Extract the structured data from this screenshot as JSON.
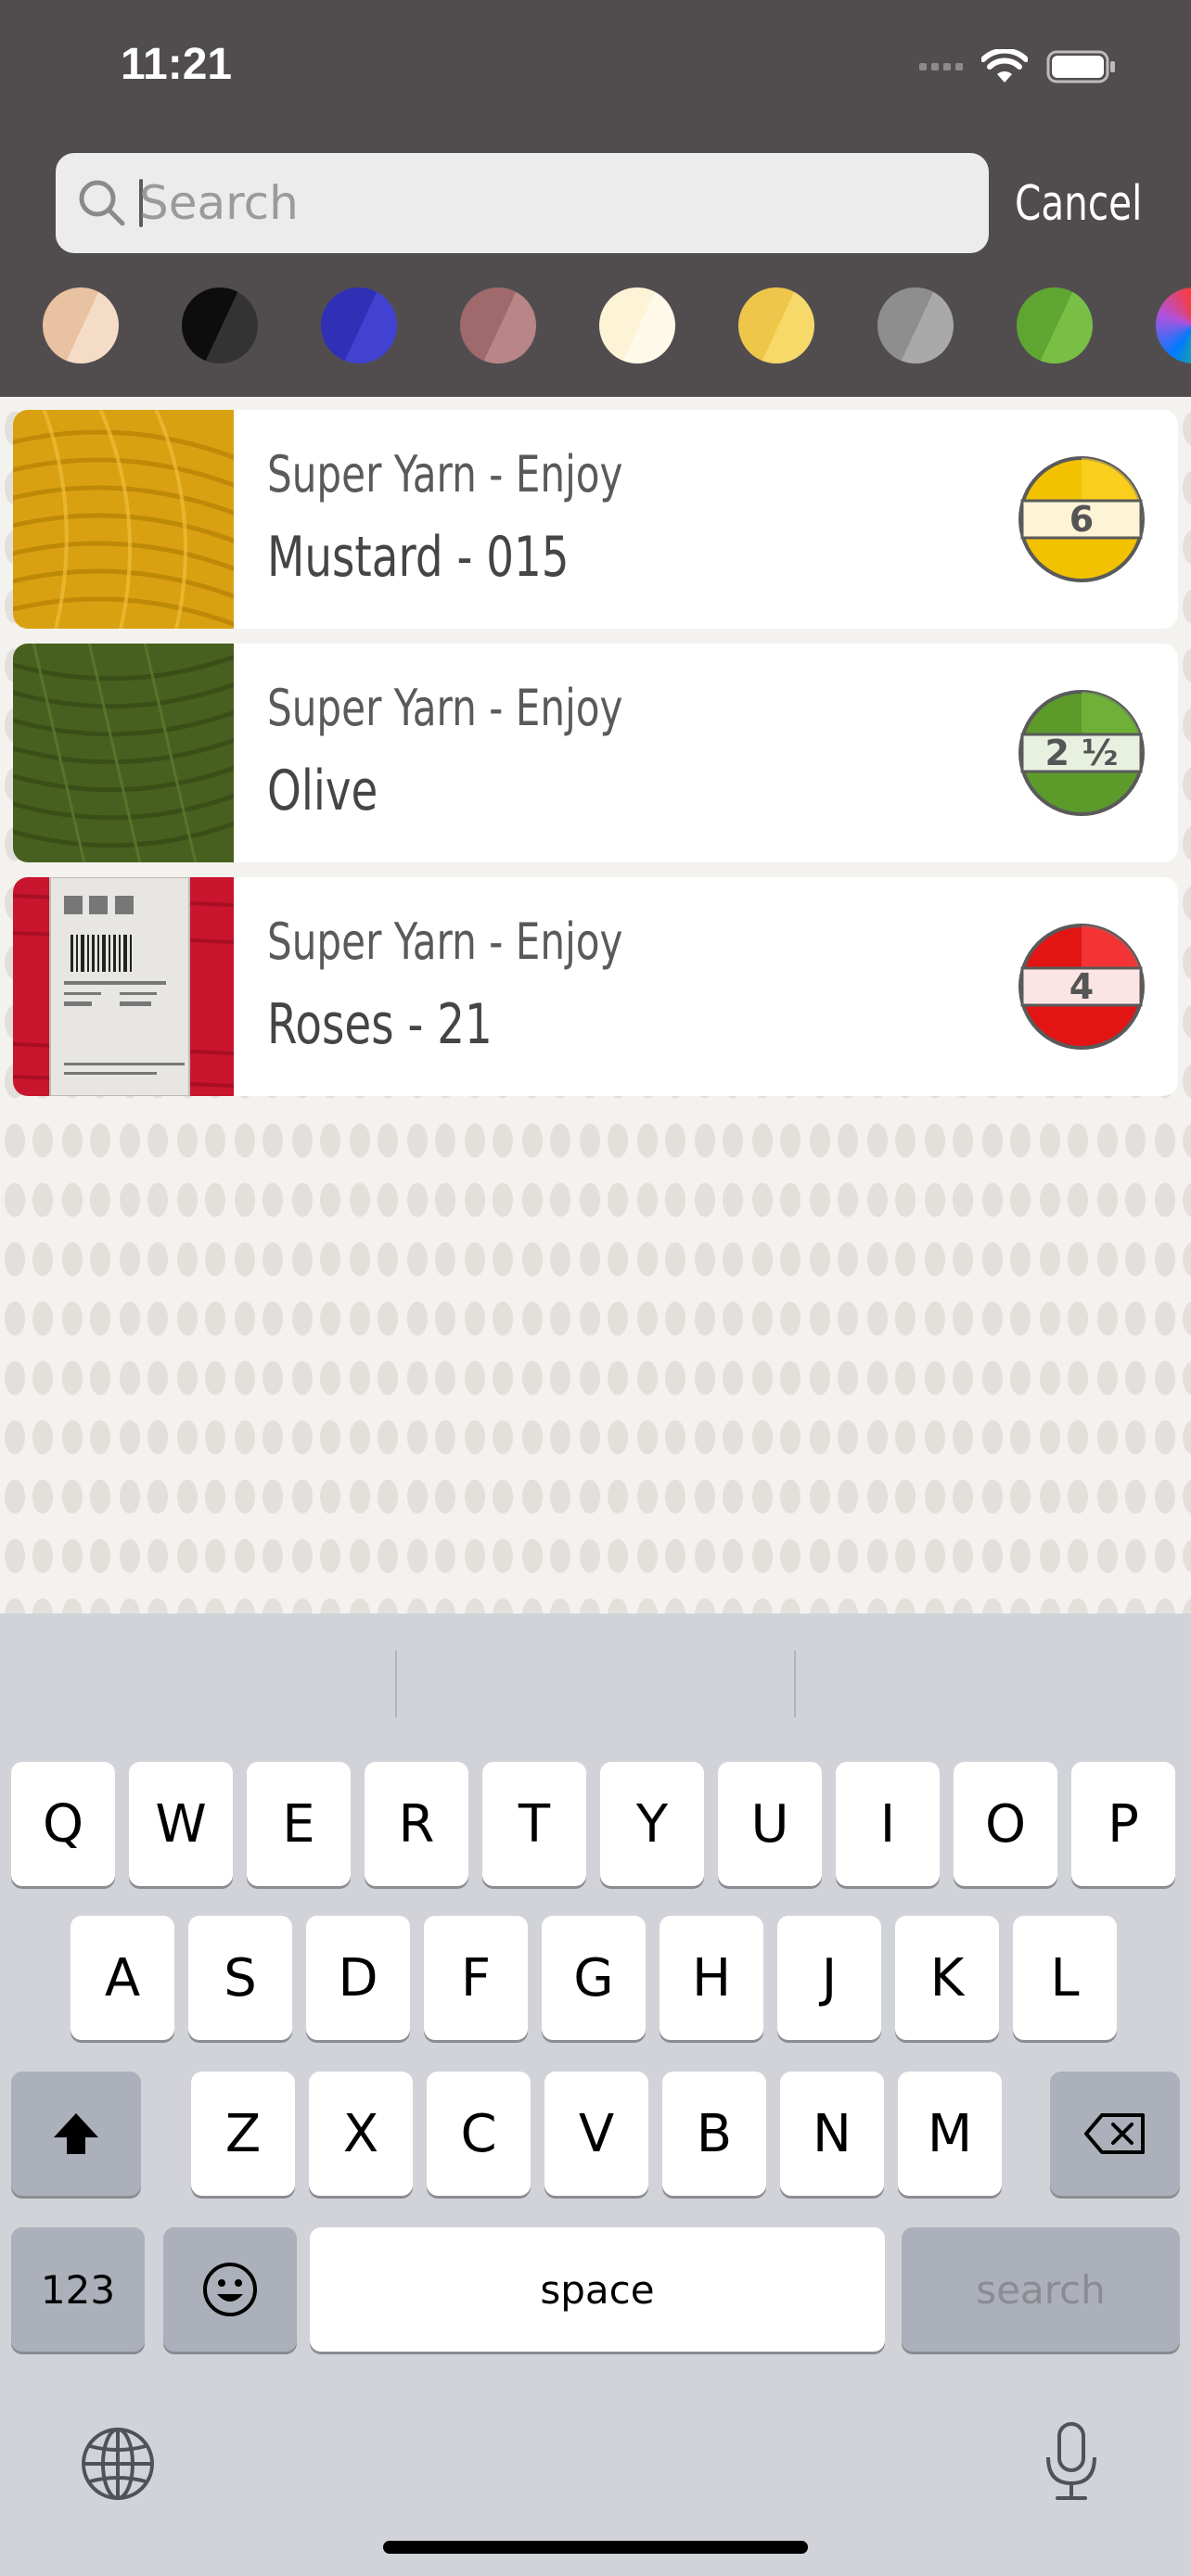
{
  "status_bar": {
    "time": "11:21"
  },
  "search": {
    "placeholder": "Search",
    "value": "",
    "cancel_label": "Cancel"
  },
  "color_filters": [
    {
      "name": "beige",
      "color_a": "#e8c2a1",
      "color_b": "#f5dcc6"
    },
    {
      "name": "black",
      "color_a": "#0d0d0d",
      "color_b": "#333333"
    },
    {
      "name": "blue",
      "color_a": "#2f30b6",
      "color_b": "#4142d2"
    },
    {
      "name": "mauve",
      "color_a": "#a06a6c",
      "color_b": "#b98586"
    },
    {
      "name": "cream",
      "color_a": "#fdf3d6",
      "color_b": "#fff9ea"
    },
    {
      "name": "yellow",
      "color_a": "#eec74a",
      "color_b": "#f7d96a"
    },
    {
      "name": "grey",
      "color_a": "#8e8e8e",
      "color_b": "#a9a9a9"
    },
    {
      "name": "green",
      "color_a": "#5fa531",
      "color_b": "#79bf45"
    },
    {
      "name": "multicolor",
      "color_a": "#ffb400",
      "color_b": "#2a7be0"
    }
  ],
  "yarns": [
    {
      "brand": "Super Yarn - Enjoy",
      "name": "Mustard - 015",
      "weight": "6",
      "badge_color": "#f2c200",
      "badge_band": "#fdf4d5",
      "thumb": "mustard"
    },
    {
      "brand": "Super Yarn - Enjoy",
      "name": "Olive",
      "weight": "2 ½",
      "badge_color": "#5c9b2a",
      "badge_band": "#e8f1e0",
      "thumb": "olive"
    },
    {
      "brand": "Super Yarn - Enjoy",
      "name": "Roses - 21",
      "weight": "4",
      "badge_color": "#e31414",
      "badge_band": "#fbe4e4",
      "thumb": "roses"
    }
  ],
  "keyboard": {
    "row1": [
      "Q",
      "W",
      "E",
      "R",
      "T",
      "Y",
      "U",
      "I",
      "O",
      "P"
    ],
    "row2": [
      "A",
      "S",
      "D",
      "F",
      "G",
      "H",
      "J",
      "K",
      "L"
    ],
    "row3": [
      "Z",
      "X",
      "C",
      "V",
      "B",
      "N",
      "M"
    ],
    "numbers_label": "123",
    "space_label": "space",
    "search_label": "search"
  }
}
